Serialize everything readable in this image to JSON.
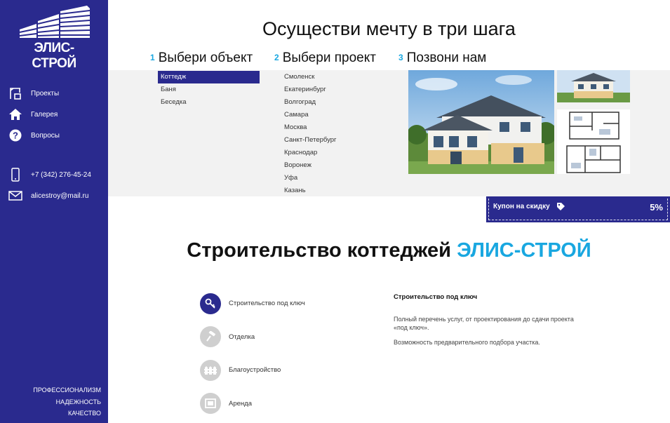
{
  "brand": {
    "logo_text": "ЭЛИС-СТРОЙ",
    "primary_color": "#2a2a8e",
    "accent_color": "#19a7e0"
  },
  "sidebar": {
    "nav": [
      {
        "label": "Проекты",
        "icon": "crane-icon"
      },
      {
        "label": "Галерея",
        "icon": "house-icon"
      },
      {
        "label": "Вопросы",
        "icon": "question-icon"
      }
    ],
    "phone": "+7 (342) 276-45-24",
    "email": "alicestroy@mail.ru",
    "footer": [
      "ПРОФЕССИОНАЛИЗМ",
      "НАДЕЖНОСТЬ",
      "КАЧЕСТВО"
    ]
  },
  "hero": {
    "title": "Осуществи мечту в три шага",
    "steps": [
      {
        "num": "1",
        "label": "Выбери объект"
      },
      {
        "num": "2",
        "label": "Выбери проект"
      },
      {
        "num": "3",
        "label": "Позвони нам"
      }
    ],
    "objects": [
      "Коттедж",
      "Баня",
      "Беседка"
    ],
    "selected_object": "Коттедж",
    "projects": [
      "Смоленск",
      "Екатеринбург",
      "Волгоград",
      "Самара",
      "Москва",
      "Санкт-Петербург",
      "Краснодар",
      "Воронеж",
      "Уфа",
      "Казань"
    ]
  },
  "coupon": {
    "label": "Купон на скидку",
    "value": "5%"
  },
  "about": {
    "title_prefix": "Строительство коттеджей",
    "title_brand": "ЭЛИС-СТРОЙ",
    "services": [
      {
        "label": "Строительство под ключ",
        "icon": "keys-icon",
        "active": true
      },
      {
        "label": "Отделка",
        "icon": "roller-icon",
        "active": false
      },
      {
        "label": "Благоустройство",
        "icon": "fence-icon",
        "active": false
      },
      {
        "label": "Аренда",
        "icon": "rent-icon",
        "active": false
      }
    ],
    "detail": {
      "title": "Строительство под ключ",
      "paragraphs": [
        "Полный перечень услуг, от проектирования до сдачи проекта «под ключ».",
        "Возможность предварительного подбора участка."
      ]
    }
  }
}
